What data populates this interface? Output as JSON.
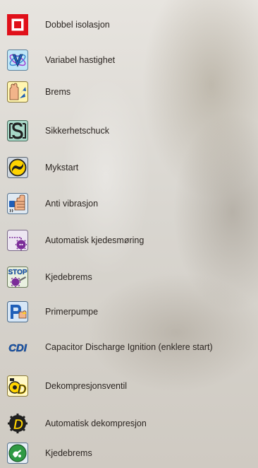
{
  "features": [
    {
      "label": "Dobbel isolasjon",
      "icon": "double-insulation-icon"
    },
    {
      "label": "Variabel hastighet",
      "icon": "variable-speed-icon"
    },
    {
      "label": "Brems",
      "icon": "brake-icon"
    },
    {
      "label": "Sikkerhetschuck",
      "icon": "safety-chuck-icon"
    },
    {
      "label": "Mykstart",
      "icon": "soft-start-icon"
    },
    {
      "label": "Anti vibrasjon",
      "icon": "anti-vibration-icon"
    },
    {
      "label": "Automatisk kjedesmøring",
      "icon": "chain-lubrication-icon"
    },
    {
      "label": "Kjedebrems",
      "icon": "stop-chain-brake-icon"
    },
    {
      "label": "Primerpumpe",
      "icon": "primer-pump-icon"
    },
    {
      "label": "Capacitor Discharge Ignition (enklere start)",
      "icon": "cdi-icon"
    },
    {
      "label": "Dekompresjonsventil",
      "icon": "decompression-valve-icon"
    },
    {
      "label": "Automatisk dekompresjon",
      "icon": "automatic-decompression-icon"
    },
    {
      "label": "Kjedebrems",
      "icon": "chain-brake-icon"
    }
  ],
  "icon_texts": {
    "stop": "STOP",
    "cdi": "CDI",
    "d": "D"
  },
  "colors": {
    "double_insulation_red": "#e0101a",
    "icon_blue": "#1f5fb8",
    "icon_yellow": "#ffd400",
    "icon_purple": "#7b2c99",
    "label_text": "#2b2521"
  }
}
